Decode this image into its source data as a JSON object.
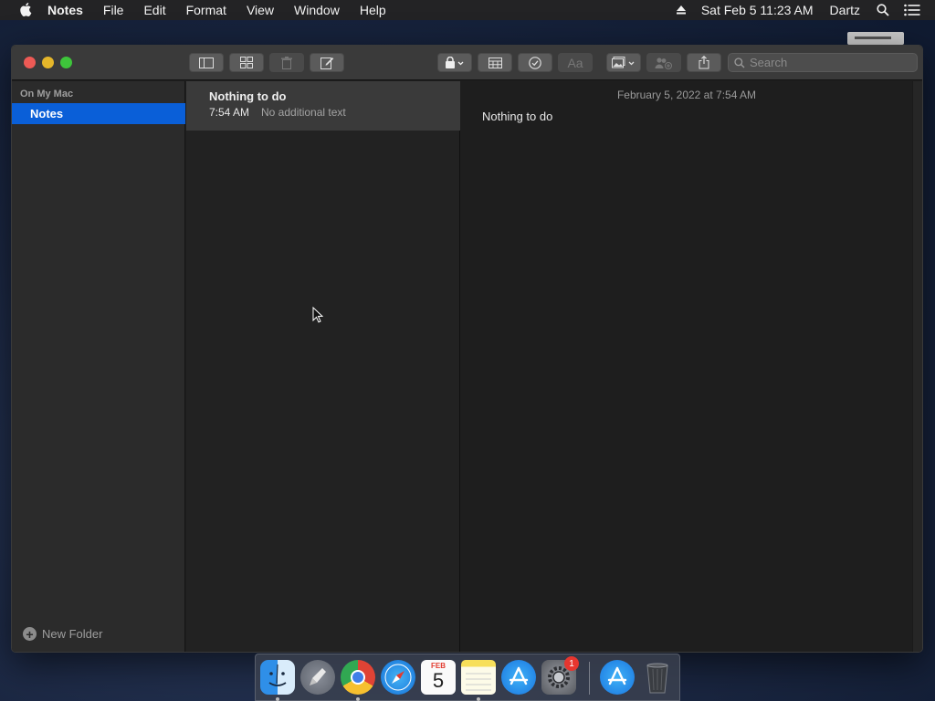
{
  "menubar": {
    "app_name": "Notes",
    "items": [
      "File",
      "Edit",
      "Format",
      "View",
      "Window",
      "Help"
    ],
    "clock": "Sat Feb 5  11:23 AM",
    "user": "Dartz"
  },
  "toolbar": {
    "search_placeholder": "Search"
  },
  "sidebar": {
    "section": "On My Mac",
    "folder": "Notes",
    "new_folder": "New Folder"
  },
  "notelist": {
    "items": [
      {
        "title": "Nothing to do",
        "time": "7:54 AM",
        "preview": "No additional text"
      }
    ]
  },
  "editor": {
    "date": "February 5, 2022 at 7:54 AM",
    "content": "Nothing to do"
  },
  "dock": {
    "apps": [
      "Finder",
      "Launchpad",
      "Chrome",
      "Safari",
      "Calendar",
      "Notes",
      "App Store",
      "System Preferences",
      "App Store Downloads",
      "Trash"
    ],
    "calendar_month": "FEB",
    "calendar_day": "5",
    "prefs_badge": "1"
  }
}
